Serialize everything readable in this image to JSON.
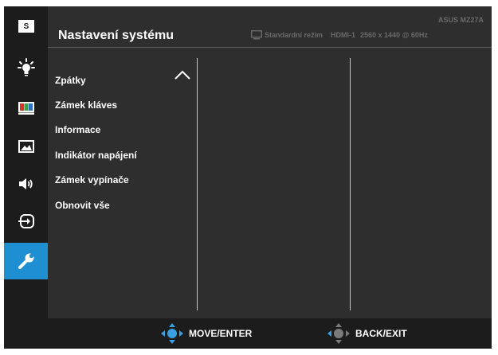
{
  "osd": {
    "title": "Nastavení systému",
    "model": "ASUS MZ27A",
    "mode": "Standardní režim",
    "input": "HDMI-1",
    "resolution": "2560 x 1440 @ 60Hz"
  },
  "sidebar": {
    "items": [
      {
        "name": "splendid",
        "icon": "splendid-s-icon",
        "glyph": "S"
      },
      {
        "name": "blue-light-filter",
        "icon": "blue-light-filter-icon"
      },
      {
        "name": "color",
        "icon": "color-icon"
      },
      {
        "name": "image",
        "icon": "image-icon"
      },
      {
        "name": "sound",
        "icon": "speaker-icon"
      },
      {
        "name": "input-select",
        "icon": "input-select-icon"
      },
      {
        "name": "system-setup",
        "icon": "wrench-icon",
        "active": true
      }
    ]
  },
  "menu": {
    "items": [
      "Zpátky",
      "Zámek kláves",
      "Informace",
      "Indikátor napájení",
      "Zámek vypínače",
      "Obnovit vše"
    ]
  },
  "footer": {
    "move_enter": "MOVE/ENTER",
    "back_exit": "BACK/EXIT"
  },
  "colors": {
    "accent": "#1e8fd0",
    "panel": "#2e2e2e",
    "sidebar": "#1c1c1c",
    "dim_text": "#6a6a6a"
  }
}
